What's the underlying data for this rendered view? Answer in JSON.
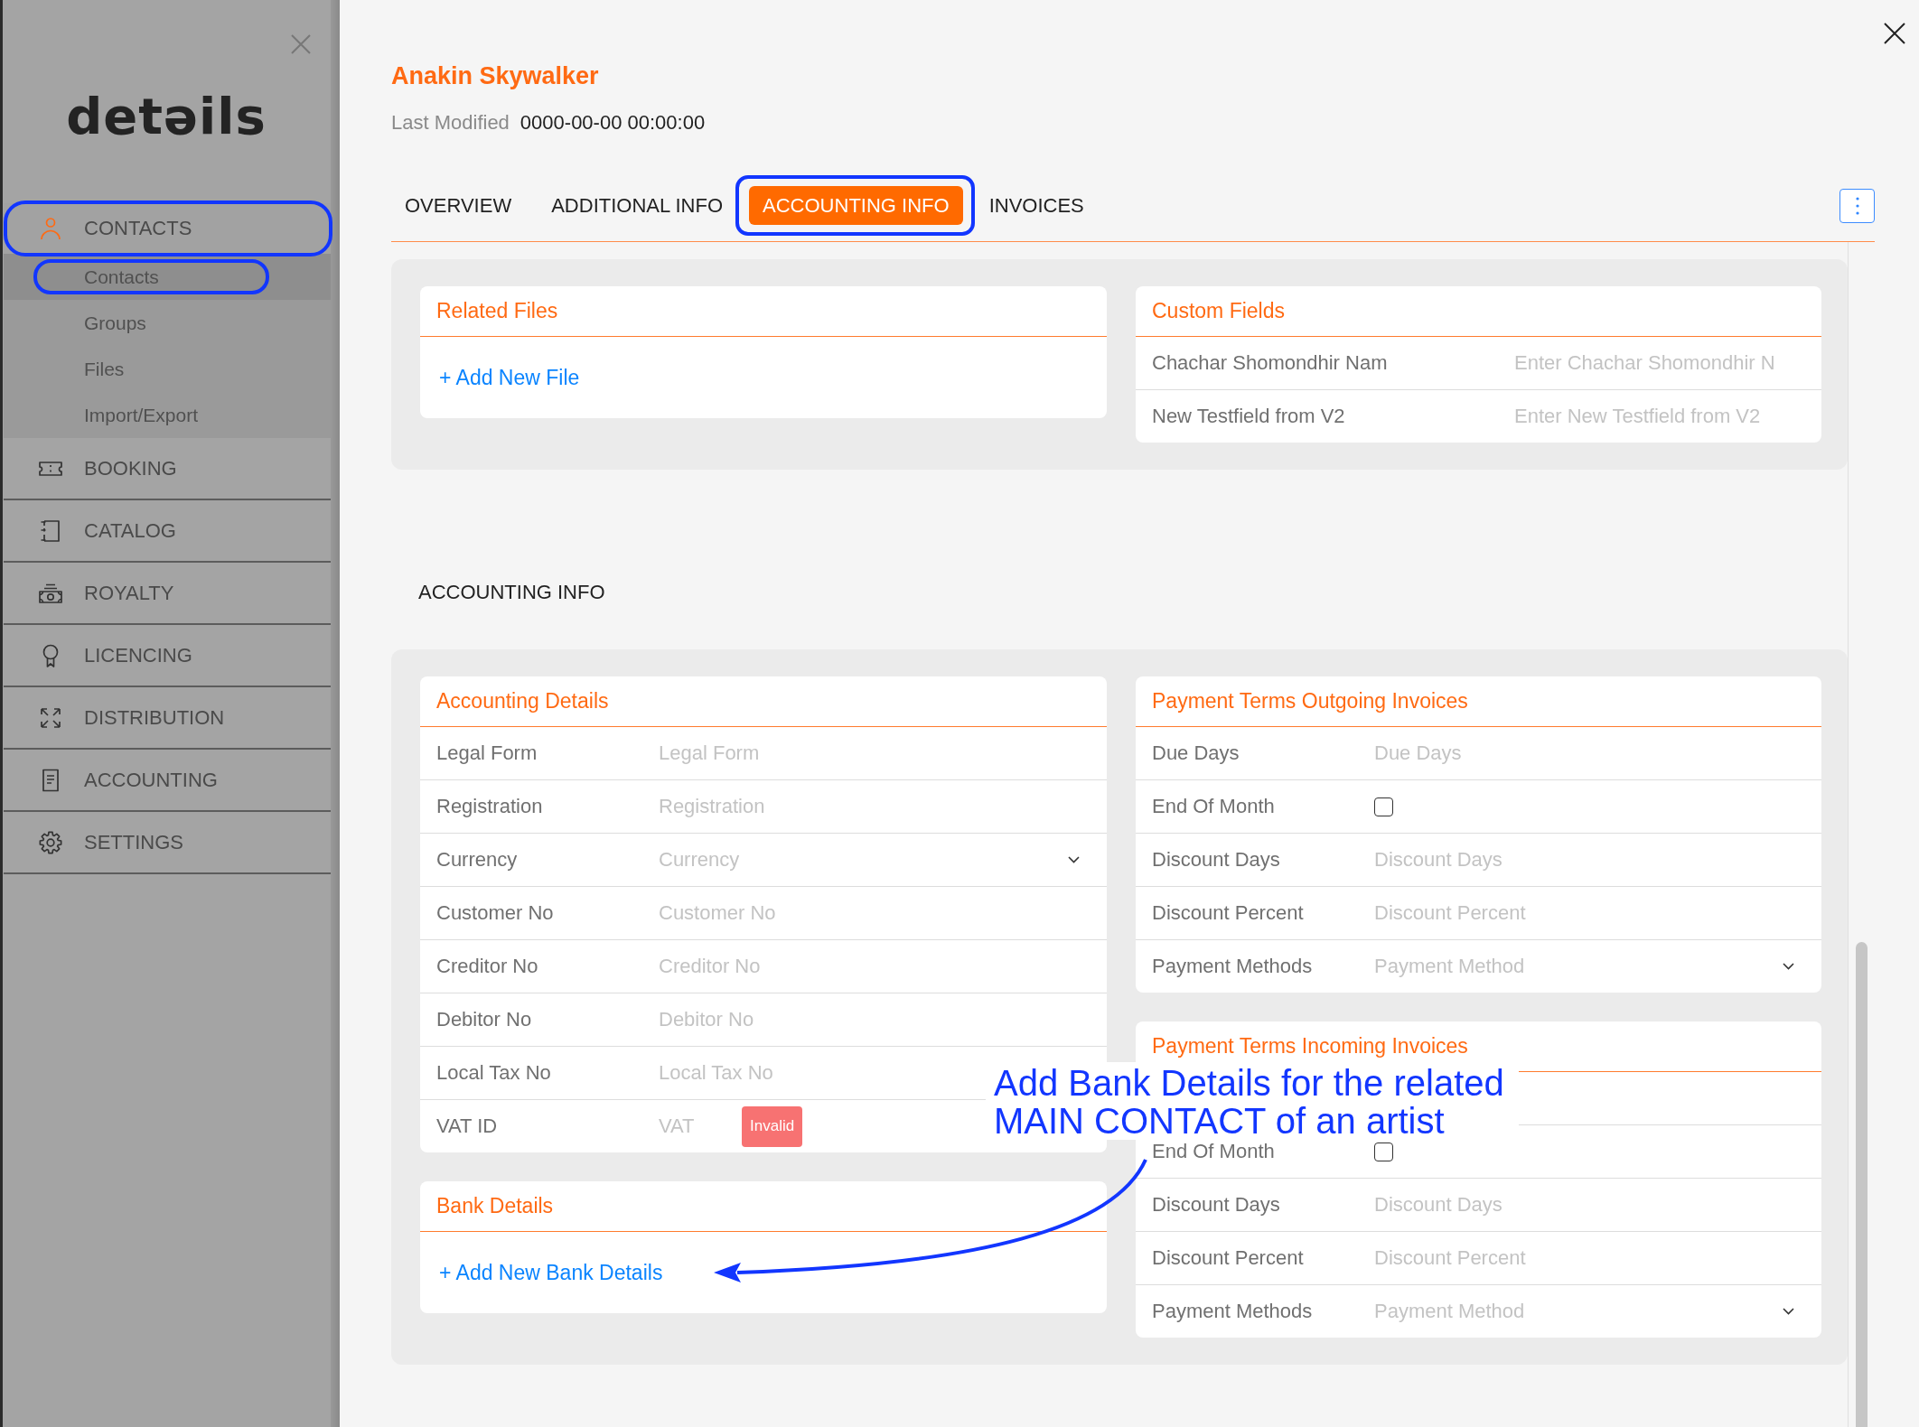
{
  "sidebar": {
    "logo": "detəils",
    "items": [
      {
        "label": "CONTACTS",
        "selected": true,
        "highlighted": true,
        "children": [
          {
            "label": "Contacts",
            "selected": true,
            "highlighted": true
          },
          {
            "label": "Groups",
            "selected": false,
            "highlighted": false
          },
          {
            "label": "Files",
            "selected": false,
            "highlighted": false
          },
          {
            "label": "Import/Export",
            "selected": false,
            "highlighted": false
          }
        ]
      },
      {
        "label": "BOOKING",
        "selected": false,
        "highlighted": false
      },
      {
        "label": "CATALOG",
        "selected": false,
        "highlighted": false
      },
      {
        "label": "ROYALTY",
        "selected": false,
        "highlighted": false
      },
      {
        "label": "LICENCING",
        "selected": false,
        "highlighted": false
      },
      {
        "label": "DISTRIBUTION",
        "selected": false,
        "highlighted": false
      },
      {
        "label": "ACCOUNTING",
        "selected": false,
        "highlighted": false
      },
      {
        "label": "SETTINGS",
        "selected": false,
        "highlighted": false
      }
    ]
  },
  "header": {
    "title": "Anakin Skywalker",
    "modified_label": "Last Modified",
    "modified_value": "0000-00-00 00:00:00"
  },
  "tabs": [
    {
      "label": "OVERVIEW",
      "selected": false,
      "highlighted": false
    },
    {
      "label": "ADDITIONAL INFO",
      "selected": false,
      "highlighted": false
    },
    {
      "label": "ACCOUNTING INFO",
      "selected": true,
      "highlighted": true
    },
    {
      "label": "INVOICES",
      "selected": false,
      "highlighted": false
    }
  ],
  "info_panel": {
    "cards": [
      {
        "kind": "link",
        "title": "Related Files",
        "link": "+ Add New File"
      },
      {
        "kind": "form",
        "title": "Custom Fields",
        "rows": [
          {
            "kind": "input",
            "label": "Chachar Shomondhir Nam",
            "placeholder": "Enter Chachar Shomondhir N"
          },
          {
            "kind": "input",
            "label": "New Testfield from V2",
            "placeholder": "Enter New Testfield from V2"
          }
        ]
      }
    ]
  },
  "section_heading": "ACCOUNTING INFO",
  "accounting_panel": {
    "columns": [
      {
        "cards": [
          {
            "kind": "form",
            "title": "Accounting Details",
            "rows": [
              {
                "kind": "input",
                "label": "Legal Form",
                "placeholder": "Legal Form"
              },
              {
                "kind": "input",
                "label": "Registration",
                "placeholder": "Registration"
              },
              {
                "kind": "dropdown",
                "label": "Currency",
                "placeholder": "Currency"
              },
              {
                "kind": "input",
                "label": "Customer No",
                "placeholder": "Customer No"
              },
              {
                "kind": "input",
                "label": "Creditor No",
                "placeholder": "Creditor No"
              },
              {
                "kind": "input",
                "label": "Debitor No",
                "placeholder": "Debitor No"
              },
              {
                "kind": "input",
                "label": "Local Tax No",
                "placeholder": "Local Tax No"
              },
              {
                "kind": "input",
                "label": "VAT ID",
                "placeholder": "VAT",
                "badge": "Invalid"
              }
            ]
          },
          {
            "kind": "link",
            "title": "Bank Details",
            "link": "+ Add New Bank Details"
          }
        ]
      },
      {
        "cards": [
          {
            "kind": "form",
            "title": "Payment Terms Outgoing Invoices",
            "rows": [
              {
                "kind": "input",
                "label": "Due Days",
                "placeholder": "Due Days"
              },
              {
                "kind": "checkbox",
                "label": "End Of Month",
                "checked": false
              },
              {
                "kind": "input",
                "label": "Discount Days",
                "placeholder": "Discount Days"
              },
              {
                "kind": "input",
                "label": "Discount Percent",
                "placeholder": "Discount Percent"
              },
              {
                "kind": "dropdown",
                "label": "Payment Methods",
                "placeholder": "Payment Method"
              }
            ]
          },
          {
            "kind": "form",
            "title": "Payment Terms Incoming Invoices",
            "rows": [
              {
                "kind": "covered"
              },
              {
                "kind": "checkbox",
                "label": "End Of Month",
                "checked": false
              },
              {
                "kind": "input",
                "label": "Discount Days",
                "placeholder": "Discount Days"
              },
              {
                "kind": "input",
                "label": "Discount Percent",
                "placeholder": "Discount Percent"
              },
              {
                "kind": "dropdown",
                "label": "Payment Methods",
                "placeholder": "Payment Method"
              }
            ]
          }
        ]
      }
    ]
  },
  "annotation": {
    "note": "Add Bank Details for the related\nMAIN CONTACT of an artist"
  }
}
